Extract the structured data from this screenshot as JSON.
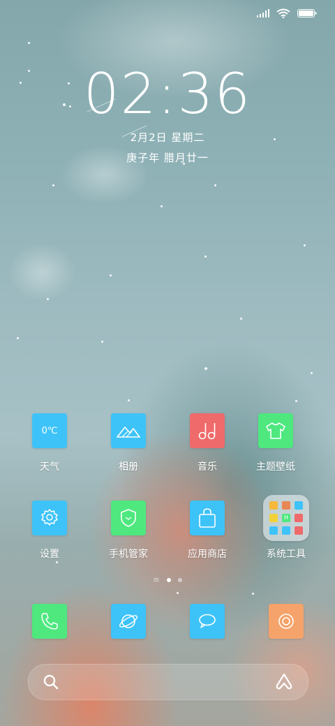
{
  "status_bar": {
    "signal": "signal-icon",
    "wifi": "wifi-icon",
    "battery": "battery-icon"
  },
  "lockscreen_clock": {
    "time": "02:36",
    "date": "2月2日 星期二",
    "lunar": "庚子年 腊月廿一"
  },
  "apps": [
    {
      "label": "天气",
      "icon": "weather-icon",
      "color": "#3ec3f8",
      "tile_text": "0℃"
    },
    {
      "label": "相册",
      "icon": "mountain-icon",
      "color": "#3ec3f8"
    },
    {
      "label": "音乐",
      "icon": "music-note-icon",
      "color": "#ef6a6a"
    },
    {
      "label": "主题壁纸",
      "icon": "tshirt-icon",
      "color": "#4ee87f"
    },
    {
      "label": "设置",
      "icon": "gear-icon",
      "color": "#3ec3f8"
    },
    {
      "label": "手机管家",
      "icon": "shield-icon",
      "color": "#4ee87f"
    },
    {
      "label": "应用商店",
      "icon": "shopping-bag-icon",
      "color": "#3ec3f8"
    },
    {
      "label": "系统工具",
      "icon": "folder-icon",
      "color": "#e6ecf0"
    }
  ],
  "folder_minis": [
    {
      "color": "#f5b83c"
    },
    {
      "color": "#e98655"
    },
    {
      "color": "#3ec3f8"
    },
    {
      "color": "#f0d13a"
    },
    {
      "color": "#4ee87f",
      "text": "H"
    },
    {
      "color": "#ef6a6a"
    },
    {
      "color": "#3ec3f8"
    },
    {
      "color": "#3ec3f8"
    },
    {
      "color": "#ef6a6a"
    }
  ],
  "pager": {
    "lines_glyph": "≡",
    "page_count": 2,
    "active_page": 1
  },
  "dock": [
    {
      "icon": "phone-icon",
      "color": "#4ee87f"
    },
    {
      "icon": "browser-icon",
      "color": "#3ec3f8"
    },
    {
      "icon": "message-icon",
      "color": "#3ec3f8"
    },
    {
      "icon": "camera-icon",
      "color": "#f5a36a"
    }
  ],
  "search_bar": {
    "search": "search-icon",
    "assistant": "assistant-icon"
  }
}
